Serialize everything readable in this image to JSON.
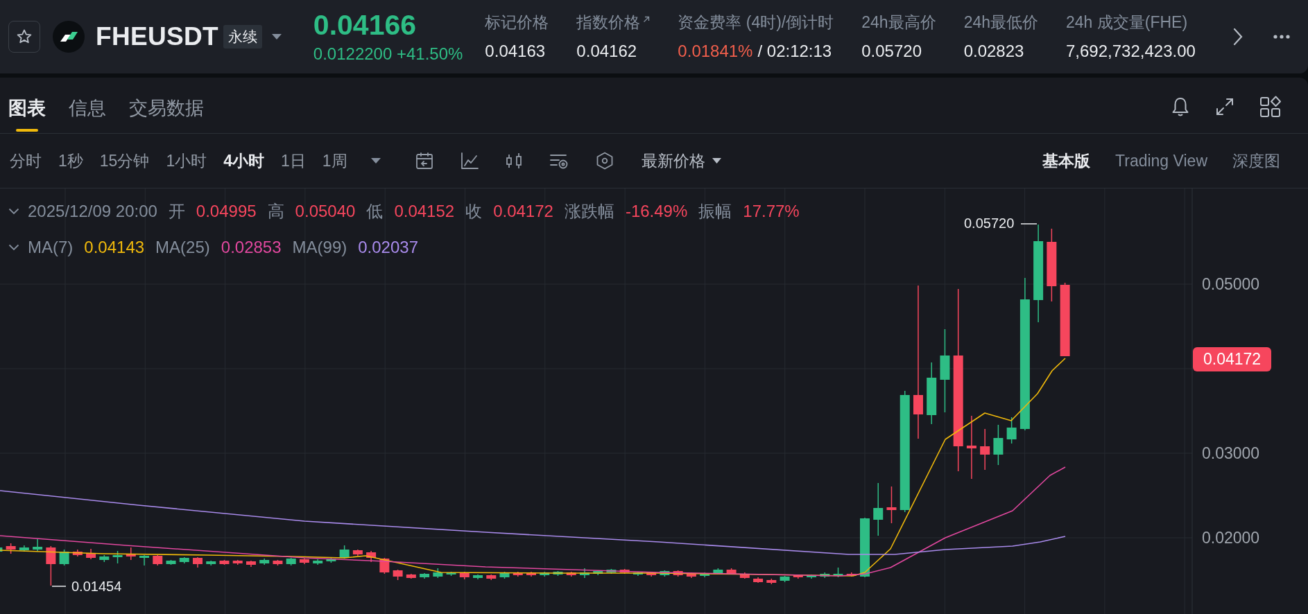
{
  "header": {
    "symbol": "FHEUSDT",
    "contract_type": "永续",
    "last_price": "0.04166",
    "rising": true,
    "change": "0.0122200",
    "change_percent": "+41.50%",
    "stats": [
      {
        "kind": "plain",
        "label": "标记价格",
        "value": "0.04163"
      },
      {
        "kind": "external",
        "label": "指数价格",
        "value": "0.04162"
      },
      {
        "kind": "rate",
        "label": "资金费率 (4时)/倒计时",
        "value": "0.01841%",
        "suffix": "/ 02:12:13"
      },
      {
        "kind": "plain",
        "label": "24h最高价",
        "value": "0.05720"
      },
      {
        "kind": "plain",
        "label": "24h最低价",
        "value": "0.02823"
      },
      {
        "kind": "plain",
        "label": "24h 成交量(FHE)",
        "value": "7,692,732,423.00"
      }
    ]
  },
  "tabs": [
    {
      "label": "图表",
      "selected": true
    },
    {
      "label": "信息",
      "selected": false
    },
    {
      "label": "交易数据",
      "selected": false
    }
  ],
  "toolbar": {
    "intervals": [
      {
        "label": "分时",
        "selected": false
      },
      {
        "label": "1秒",
        "selected": false
      },
      {
        "label": "15分钟",
        "selected": false
      },
      {
        "label": "1小时",
        "selected": false
      },
      {
        "label": "4小时",
        "selected": true
      },
      {
        "label": "1日",
        "selected": false
      },
      {
        "label": "1周",
        "selected": false
      }
    ],
    "price_source": "最新价格",
    "views": [
      {
        "label": "基本版",
        "selected": true
      },
      {
        "label": "Trading View",
        "selected": false
      },
      {
        "label": "深度图",
        "selected": false
      }
    ]
  },
  "chart": {
    "ohlc_legend": {
      "time": "2025/12/09 20:00",
      "rising": false,
      "fields": [
        {
          "label": "开",
          "value": "0.04995"
        },
        {
          "label": "高",
          "value": "0.05040"
        },
        {
          "label": "低",
          "value": "0.04152"
        },
        {
          "label": "收",
          "value": "0.04172"
        },
        {
          "label": "涨跌幅",
          "value": "-16.49%"
        },
        {
          "label": "振幅",
          "value": "17.77%"
        }
      ]
    },
    "ma_legend": [
      {
        "label": "MA(7)",
        "value": "0.04143",
        "color": "#f0b90b"
      },
      {
        "label": "MA(25)",
        "value": "0.02853",
        "color": "#e2489f"
      },
      {
        "label": "MA(99)",
        "value": "0.02037",
        "color": "#a98bec"
      }
    ],
    "high_marker": "0.05720",
    "low_marker": "0.01454",
    "price_axis": [
      "0.05000",
      "0.03000",
      "0.02000"
    ],
    "last_price_tag": "0.04172"
  }
}
